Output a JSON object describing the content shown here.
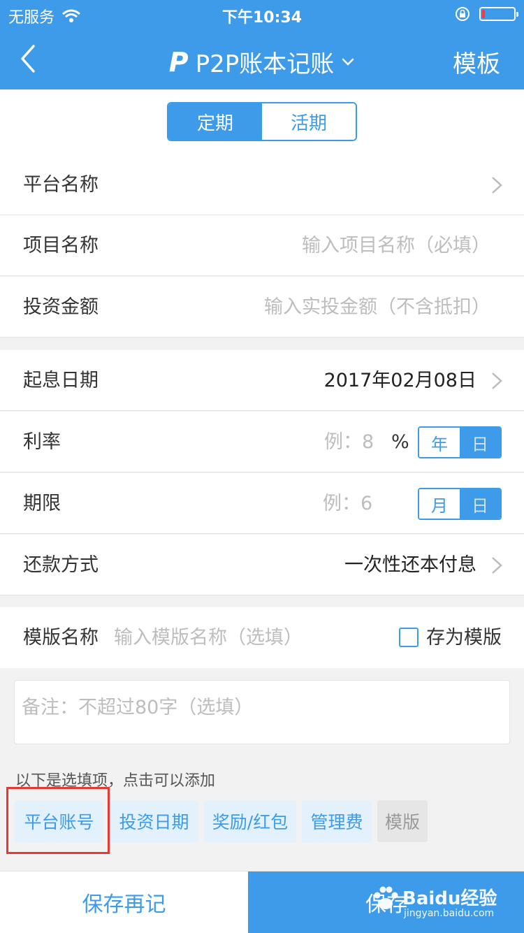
{
  "status_bar": {
    "carrier": "无服务",
    "time": "下午10:34"
  },
  "nav": {
    "title": "P2P账本记账",
    "right_label": "模板",
    "logo_letter": "P"
  },
  "segment": {
    "tabs": [
      "定期",
      "活期"
    ],
    "active": 0
  },
  "form": {
    "platform_name": {
      "label": "平台名称"
    },
    "project_name": {
      "label": "项目名称",
      "placeholder": "输入项目名称（必填）"
    },
    "amount": {
      "label": "投资金额",
      "placeholder": "输入实投金额（不含抵扣）"
    },
    "start_date": {
      "label": "起息日期",
      "value": "2017年02月08日"
    },
    "rate": {
      "label": "利率",
      "placeholder": "例：8",
      "unit_symbol": "%",
      "units": [
        "年",
        "日"
      ]
    },
    "term": {
      "label": "期限",
      "placeholder": "例：6",
      "units": [
        "月",
        "日"
      ]
    },
    "repayment": {
      "label": "还款方式",
      "value": "一次性还本付息"
    },
    "template_name": {
      "label": "模版名称",
      "placeholder": "输入模版名称（选填）",
      "checkbox_label": "存为模版"
    },
    "remark": {
      "placeholder": "备注：不超过80字（选填）"
    }
  },
  "optional": {
    "title": "以下是选填项，点击可以添加",
    "chips": [
      "平台账号",
      "投资日期",
      "奖励/红包",
      "管理费",
      "模版"
    ]
  },
  "bottom": {
    "save_again": "保存再记",
    "save": "保存"
  },
  "watermark": {
    "text": "Baidu经验",
    "sub": "jingyan.baidu.com"
  },
  "colors": {
    "primary": "#3d9be9",
    "highlight": "#e53935",
    "chip_bg": "#e3f1fc"
  }
}
